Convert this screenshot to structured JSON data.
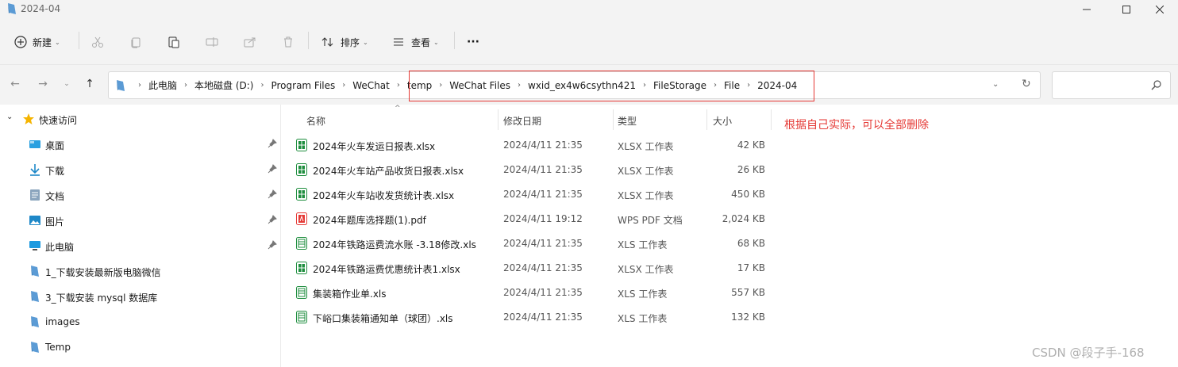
{
  "window": {
    "title": "2024-04"
  },
  "toolbar": {
    "new_label": "新建",
    "sort_label": "排序",
    "view_label": "查看",
    "more_label": "···"
  },
  "address": {
    "crumbs": [
      "此电脑",
      "本地磁盘 (D:)",
      "Program Files",
      "WeChat",
      "temp",
      "WeChat Files",
      "wxid_ex4w6csythn421",
      "FileStorage",
      "File",
      "2024-04"
    ]
  },
  "search": {
    "placeholder": ""
  },
  "sidebar": {
    "quick_access_label": "快速访问",
    "items": [
      {
        "label": "桌面",
        "icon": "desktop-icon",
        "pinned": true
      },
      {
        "label": "下载",
        "icon": "download-icon",
        "pinned": true
      },
      {
        "label": "文档",
        "icon": "document-icon",
        "pinned": true
      },
      {
        "label": "图片",
        "icon": "picture-icon",
        "pinned": true
      },
      {
        "label": "此电脑",
        "icon": "computer-icon",
        "pinned": true
      },
      {
        "label": "1_下载安装最新版电脑微信",
        "icon": "folder-icon",
        "pinned": false
      },
      {
        "label": "3_下载安装 mysql 数据库",
        "icon": "folder-icon",
        "pinned": false
      },
      {
        "label": "images",
        "icon": "folder-icon",
        "pinned": false
      },
      {
        "label": "Temp",
        "icon": "folder-icon",
        "pinned": false
      }
    ]
  },
  "columns": {
    "name": "名称",
    "modified": "修改日期",
    "type": "类型",
    "size": "大小"
  },
  "files": [
    {
      "name": "2024年火车发运日报表.xlsx",
      "modified": "2024/4/11 21:35",
      "type": "XLSX 工作表",
      "size": "42 KB",
      "icon": "excel-icon"
    },
    {
      "name": "2024年火车站产品收货日报表.xlsx",
      "modified": "2024/4/11 21:35",
      "type": "XLSX 工作表",
      "size": "26 KB",
      "icon": "excel-icon"
    },
    {
      "name": "2024年火车站收发货统计表.xlsx",
      "modified": "2024/4/11 21:35",
      "type": "XLSX 工作表",
      "size": "450 KB",
      "icon": "excel-icon"
    },
    {
      "name": "2024年题库选择题(1).pdf",
      "modified": "2024/4/11 19:12",
      "type": "WPS PDF 文档",
      "size": "2,024 KB",
      "icon": "pdf-icon"
    },
    {
      "name": "2024年铁路运费流水账 -3.18修改.xls",
      "modified": "2024/4/11 21:35",
      "type": "XLS 工作表",
      "size": "68 KB",
      "icon": "xls-icon"
    },
    {
      "name": "2024年铁路运费优惠统计表1.xlsx",
      "modified": "2024/4/11 21:35",
      "type": "XLSX 工作表",
      "size": "17 KB",
      "icon": "excel-icon"
    },
    {
      "name": "集装箱作业单.xls",
      "modified": "2024/4/11 21:35",
      "type": "XLS 工作表",
      "size": "557 KB",
      "icon": "xls-icon"
    },
    {
      "name": "下峪口集装箱通知单（球团）.xls",
      "modified": "2024/4/11 21:35",
      "type": "XLS 工作表",
      "size": "132 KB",
      "icon": "xls-icon"
    }
  ],
  "annotation": "根据自己实际，可以全部删除",
  "watermark": "CSDN @段子手-168",
  "colors": {
    "accent": "#0067c0",
    "annotation": "#e53935",
    "excel": "#1e8e3e",
    "pdf": "#e53935"
  }
}
